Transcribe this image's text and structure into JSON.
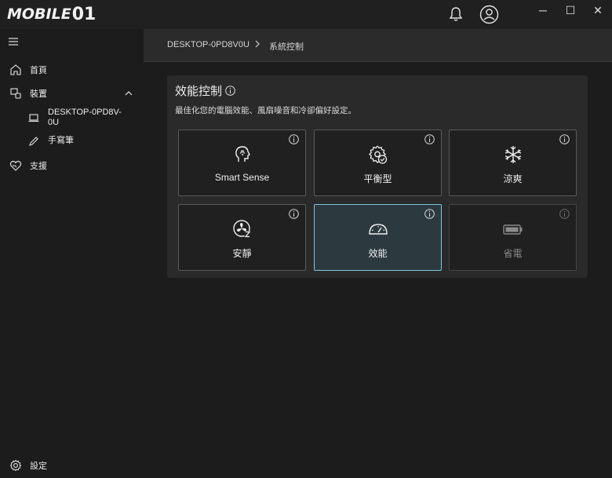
{
  "app": {
    "logo_text": "MOBILE",
    "logo_num": "01"
  },
  "window": {
    "minimize": "─",
    "maximize": "☐",
    "close": "✕"
  },
  "sidebar": {
    "items": [
      {
        "label": "首頁",
        "icon": "home-icon"
      },
      {
        "label": "裝置",
        "icon": "devices-icon"
      },
      {
        "label": "支援",
        "icon": "support-icon"
      }
    ],
    "sub_items": [
      {
        "label": "DESKTOP-0PD8V-0U",
        "icon": "laptop-icon"
      },
      {
        "label": "手寫筆",
        "icon": "pen-icon"
      }
    ],
    "settings_label": "設定"
  },
  "breadcrumb": {
    "device": "DESKTOP-0PD8V0U",
    "page": "系統控制"
  },
  "panel": {
    "title": "效能控制",
    "description": "最佳化您的電腦效能、風扇噪音和冷卻偏好設定。"
  },
  "modes": [
    {
      "label": "Smart Sense",
      "icon": "smart-sense-icon",
      "state": "normal"
    },
    {
      "label": "平衡型",
      "icon": "balanced-gear-icon",
      "state": "normal"
    },
    {
      "label": "涼爽",
      "icon": "snowflake-icon",
      "state": "normal"
    },
    {
      "label": "安靜",
      "icon": "quiet-fan-icon",
      "state": "normal"
    },
    {
      "label": "效能",
      "icon": "speedometer-icon",
      "state": "selected"
    },
    {
      "label": "省電",
      "icon": "battery-icon",
      "state": "disabled"
    }
  ],
  "colors": {
    "accent": "#7fc6de",
    "selected_bg": "#2c3a40",
    "background": "#1c1c1c",
    "panel": "#2a2a2a"
  }
}
